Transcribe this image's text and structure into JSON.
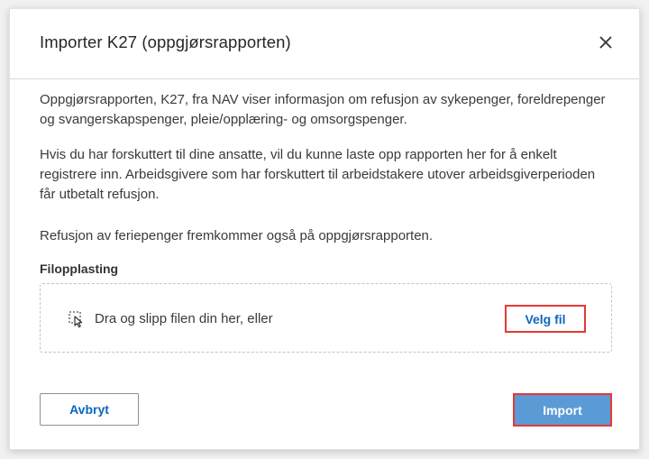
{
  "dialog": {
    "title": "Importer K27 (oppgjørsrapporten)",
    "close_icon": "close-icon",
    "paragraphs": [
      "Oppgjørsrapporten, K27, fra NAV viser informasjon om refusjon av sykepenger, foreldrepenger og svangerskapspenger, pleie/opplæring- og omsorgspenger.",
      "Hvis du har forskuttert til dine ansatte, vil du kunne laste opp rapporten her for å enkelt registrere inn. Arbeidsgivere som har forskuttert til arbeidstakere utover arbeidsgiverperioden får utbetalt refusjon.",
      "Refusjon av feriepenger fremkommer også på oppgjørsrapporten."
    ],
    "upload": {
      "label": "Filopplasting",
      "icon": "file-drop-icon",
      "drop_text": "Dra og slipp filen din her, eller",
      "browse_label": "Velg fil"
    },
    "buttons": {
      "cancel_label": "Avbryt",
      "import_label": "Import"
    }
  },
  "colors": {
    "accent": "#0a66c2",
    "primary_button": "#5b9bd5",
    "highlight_border": "#e53935"
  }
}
